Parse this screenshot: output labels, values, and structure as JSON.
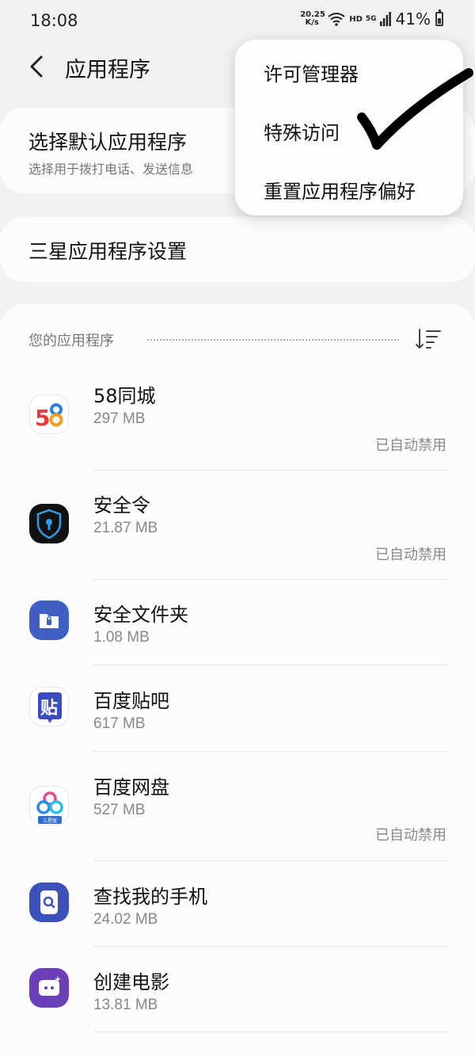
{
  "status_bar": {
    "time": "18:08",
    "net_speed_value": "20.25",
    "net_speed_unit": "K/s",
    "hd_label": "HD",
    "network_label": "5G",
    "battery_percent": "41%"
  },
  "header": {
    "title": "应用程序"
  },
  "default_apps": {
    "title": "选择默认应用程序",
    "subtitle": "选择用于拨打电话、发送信息"
  },
  "samsung_settings": {
    "title": "三星应用程序设置"
  },
  "apps_section": {
    "header": "您的应用程序",
    "apps": [
      {
        "name": "58同城",
        "size": "297 MB",
        "status": "已自动禁用",
        "icon": "58-tongcheng-icon"
      },
      {
        "name": "安全令",
        "size": "21.87 MB",
        "status": "已自动禁用",
        "icon": "shield-lock-icon"
      },
      {
        "name": "安全文件夹",
        "size": "1.08 MB",
        "status": "",
        "icon": "secure-folder-icon"
      },
      {
        "name": "百度贴吧",
        "size": "617 MB",
        "status": "",
        "icon": "tieba-icon"
      },
      {
        "name": "百度网盘",
        "size": "527 MB",
        "status": "已自动禁用",
        "icon": "baidu-netdisk-icon"
      },
      {
        "name": "查找我的手机",
        "size": "24.02 MB",
        "status": "",
        "icon": "find-my-mobile-icon"
      },
      {
        "name": "创建电影",
        "size": "13.81 MB",
        "status": "",
        "icon": "create-movie-icon"
      }
    ]
  },
  "overflow_menu": {
    "items": [
      "许可管理器",
      "特殊访问",
      "重置应用程序偏好"
    ]
  },
  "netdisk_badge": "三星版",
  "tieba_glyph": "贴",
  "colors": {
    "background": "#f2f2f4",
    "card": "#fcfcfc",
    "accent_blue": "#3b5bb5"
  }
}
